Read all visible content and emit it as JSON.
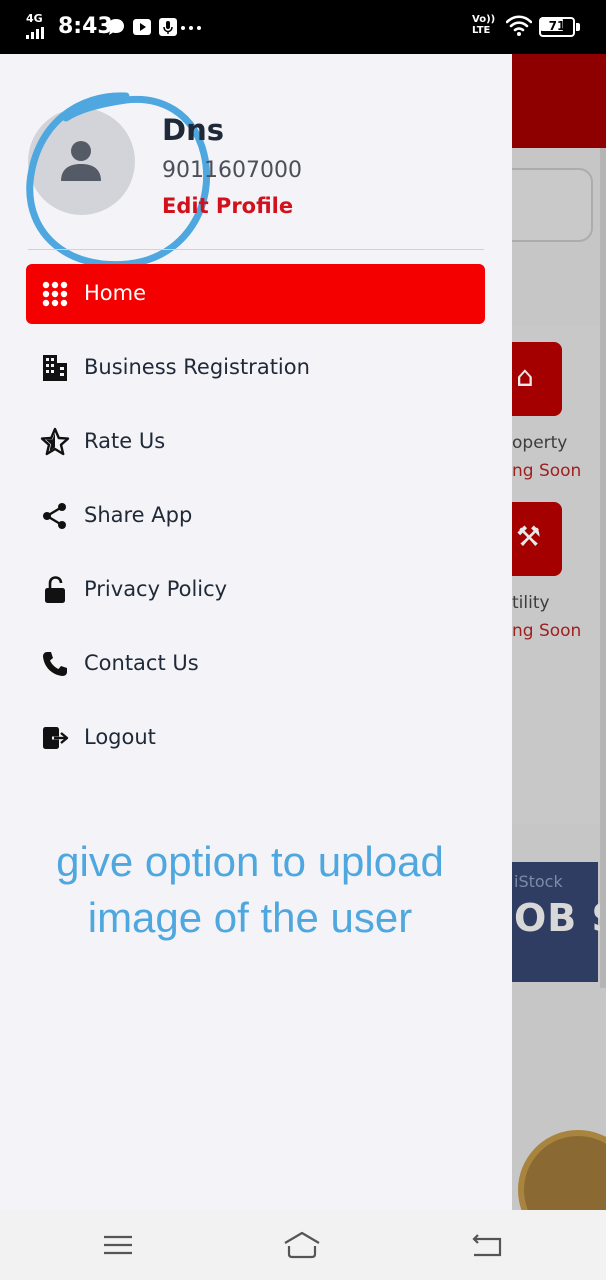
{
  "status_bar": {
    "network": "4G",
    "time": "8:43",
    "volte_line1": "Vo))",
    "volte_line2": "LTE",
    "battery": "71",
    "icons": [
      "chat-bubble-icon",
      "youtube-icon",
      "mic-icon",
      "more-icon",
      "wifi-icon",
      "battery-icon"
    ]
  },
  "profile": {
    "name": "Dns",
    "phone": "9011607000",
    "edit_label": "Edit Profile",
    "avatar_icon": "person-icon"
  },
  "menu": {
    "items": [
      {
        "label": "Home",
        "icon": "grid-icon",
        "active": true
      },
      {
        "label": "Business Registration",
        "icon": "building-icon",
        "active": false
      },
      {
        "label": "Rate Us",
        "icon": "star-icon",
        "active": false
      },
      {
        "label": "Share App",
        "icon": "share-icon",
        "active": false
      },
      {
        "label": "Privacy Policy",
        "icon": "unlock-icon",
        "active": false
      },
      {
        "label": "Contact Us",
        "icon": "phone-icon",
        "active": false
      },
      {
        "label": "Logout",
        "icon": "logout-icon",
        "active": false
      }
    ]
  },
  "annotation": {
    "line1": "give option to upload",
    "line2": "image of the user"
  },
  "background_app": {
    "tile1_label": "operty",
    "tile1_status": "ng Soon",
    "tile2_label": "tility",
    "tile2_status": "ng Soon",
    "banner_text": "OB SI",
    "banner_sub": "iStock"
  },
  "colors": {
    "accent": "#f40000",
    "edit_profile": "#d1121d",
    "annotation": "#4ea8df",
    "drawer_bg": "#f4f4f8"
  }
}
